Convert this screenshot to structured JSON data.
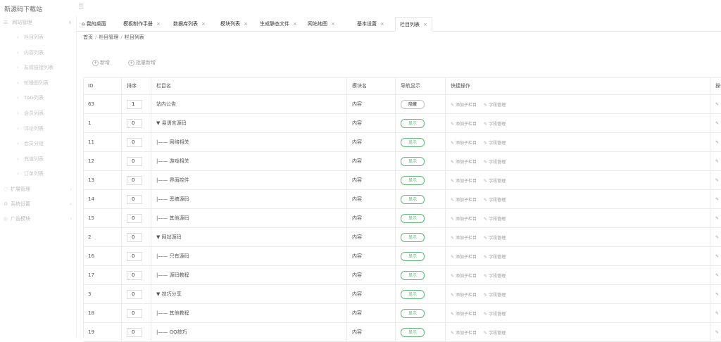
{
  "app": {
    "title": "新源码下载站",
    "menu_icon": "hamburger-icon"
  },
  "sidebar": {
    "group_main": "网站管理",
    "items": [
      "栏目列表",
      "内容列表",
      "友情链接列表",
      "轮播图列表",
      "TAG列表",
      "会员列表",
      "评论列表",
      "会员分组",
      "充值列表",
      "订单列表"
    ],
    "groups": [
      {
        "label": "扩展管理",
        "icon": "extension-icon"
      },
      {
        "label": "系统设置",
        "icon": "gear-icon"
      },
      {
        "label": "广告模块",
        "icon": "ad-icon"
      }
    ]
  },
  "tabs": {
    "home": "我的桌面",
    "items": [
      "模板制作手册",
      "数据库列表",
      "模块列表",
      "生成静态文件",
      "网站地图",
      "基本设置",
      "栏目列表"
    ],
    "active_index": 6
  },
  "breadcrumb": {
    "home": "首页",
    "section": "栏目管理",
    "current": "栏目列表"
  },
  "actions": {
    "add": "新增",
    "batch_add": "批量新增"
  },
  "table": {
    "headers": {
      "id": "ID",
      "sort": "排序",
      "name": "栏目名",
      "module": "模块名",
      "nav": "导航显示",
      "quick": "快捷操作",
      "op": "操作"
    },
    "quick_actions": {
      "add_child": "添加子栏目",
      "fields": "字段管理"
    },
    "rows": [
      {
        "id": "63",
        "sort": "1",
        "name": "站内公告",
        "module": "内容",
        "nav": "隐藏",
        "show": false
      },
      {
        "id": "1",
        "sort": "0",
        "name": "▼ 易语言源码",
        "module": "内容",
        "nav": "显示",
        "show": true
      },
      {
        "id": "11",
        "sort": "0",
        "name": "|—— 网络相关",
        "module": "内容",
        "nav": "显示",
        "show": true
      },
      {
        "id": "12",
        "sort": "0",
        "name": "|—— 游戏相关",
        "module": "内容",
        "nav": "显示",
        "show": true
      },
      {
        "id": "13",
        "sort": "0",
        "name": "|—— 界面控件",
        "module": "内容",
        "nav": "显示",
        "show": true
      },
      {
        "id": "14",
        "sort": "0",
        "name": "|—— 恶搞源码",
        "module": "内容",
        "nav": "显示",
        "show": true
      },
      {
        "id": "15",
        "sort": "0",
        "name": "|—— 其他源码",
        "module": "内容",
        "nav": "显示",
        "show": true
      },
      {
        "id": "2",
        "sort": "0",
        "name": "▼ 网站源码",
        "module": "内容",
        "nav": "显示",
        "show": true
      },
      {
        "id": "16",
        "sort": "0",
        "name": "|—— 只有源码",
        "module": "内容",
        "nav": "显示",
        "show": true
      },
      {
        "id": "17",
        "sort": "0",
        "name": "|—— 源码教程",
        "module": "内容",
        "nav": "显示",
        "show": true
      },
      {
        "id": "3",
        "sort": "0",
        "name": "▼ 技巧分享",
        "module": "内容",
        "nav": "显示",
        "show": true
      },
      {
        "id": "18",
        "sort": "0",
        "name": "|—— 其他教程",
        "module": "内容",
        "nav": "显示",
        "show": true
      },
      {
        "id": "19",
        "sort": "0",
        "name": "|—— QQ技巧",
        "module": "内容",
        "nav": "显示",
        "show": true
      }
    ]
  },
  "colors": {
    "accent": "#5fb878",
    "border": "#ebebeb",
    "muted": "#999999"
  }
}
